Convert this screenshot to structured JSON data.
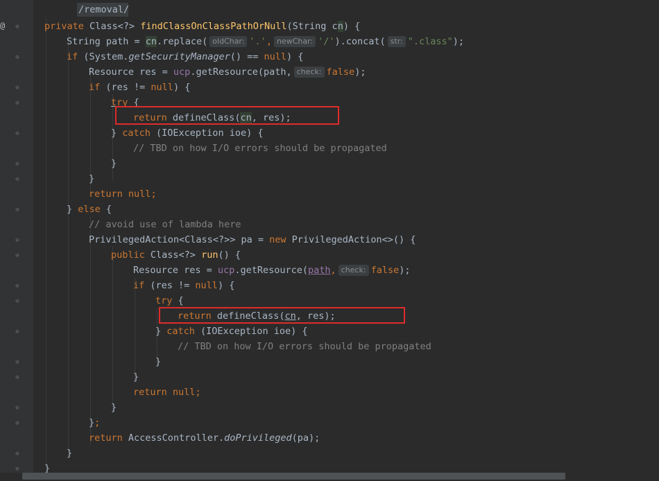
{
  "editor": {
    "gutter_marker": "@",
    "path_label": "/removal/",
    "lines": {
      "l1": {
        "kw1": "private",
        "t1": " Class<?> ",
        "fn": "findClassOnClassPathOrNull",
        "t2": "(String ",
        "cnA": "c",
        "cnB": "n",
        "t3": ") {"
      },
      "l2": {
        "t1": "String path = ",
        "cn": "cn",
        "t2": ".replace(",
        "hint1": "oldChar:",
        "s1": "'.'",
        "comma1": ",",
        "hint2": "newChar:",
        "s2": "'/'",
        "t3": ").concat(",
        "hint3": "str:",
        "s3": "\".class\"",
        "t4": ");"
      },
      "l3": {
        "kw": "if",
        "t1": " (System.",
        "m": "getSecurityManager",
        "t2": "() == ",
        "n": "null",
        "t3": ") {"
      },
      "l4": {
        "t1": "Resource res = ",
        "ucp": "ucp",
        "t2": ".getResource(path,",
        "hint": "check:",
        "f": "false",
        "t3": ");"
      },
      "l5": {
        "kw": "if",
        "t1": " (res != ",
        "n": "null",
        "t2": ") {"
      },
      "l6": {
        "kw": "try",
        "t1": " {"
      },
      "l7": {
        "kw": "return",
        "t1": " defineClass(",
        "cn": "cn",
        "t2": ", res);"
      },
      "l8": {
        "t1": "} ",
        "kw": "catch",
        "t2": " (IOException ioe) {"
      },
      "l9": {
        "cm": "// TBD on how I/O errors should be propagated"
      },
      "l10": {
        "t1": "}"
      },
      "l11": {
        "t1": "}"
      },
      "l12": {
        "kw": "return",
        "t1": " ",
        "n": "null",
        "t2": ";"
      },
      "l13": {
        "t1": "} ",
        "kw": "else",
        "t2": " {"
      },
      "l14": {
        "cm": "// avoid use of lambda here"
      },
      "l15": {
        "t1": "PrivilegedAction<Class<?>> pa = ",
        "kw": "new",
        "t2": " PrivilegedAction<>() {"
      },
      "l16": {
        "kw": "public",
        "t1": " Class<?> ",
        "fn": "run",
        "t2": "() {"
      },
      "l17": {
        "t1": "Resource res = ",
        "ucp": "ucp",
        "t2": ".getResource(",
        "path": "path",
        "comma": ",",
        "hint": "check:",
        "f": "false",
        "t3": ");"
      },
      "l18": {
        "kw": "if",
        "t1": " (res != ",
        "n": "null",
        "t2": ") {"
      },
      "l19": {
        "kw": "try",
        "t1": " {"
      },
      "l20": {
        "kw": "return",
        "t1": " defineClass(",
        "cn": "cn",
        "t2": ", res);"
      },
      "l21": {
        "t1": "} ",
        "kw": "catch",
        "t2": " (IOException ioe) {"
      },
      "l22": {
        "cm": "// TBD on how I/O errors should be propagated"
      },
      "l23": {
        "t1": "}"
      },
      "l24": {
        "t1": "}"
      },
      "l25": {
        "kw": "return",
        "t1": " ",
        "n": "null",
        "t2": ";"
      },
      "l26": {
        "t1": "}"
      },
      "l27": {
        "t1": "}",
        "semi": ";"
      },
      "l28": {
        "kw": "return",
        "t1": " AccessController.",
        "m": "doPrivileged",
        "t2": "(pa);"
      },
      "l29": {
        "t1": "}"
      },
      "l30": {
        "t1": "}"
      }
    }
  },
  "colors": {
    "background": "#2b2b2b",
    "keyword": "#cc7832",
    "method_decl": "#ffc66d",
    "string": "#6a8759",
    "comment": "#808080",
    "field": "#9876aa",
    "highlight_box": "#e02b2b"
  },
  "icons": [
    "fold-marker-icon",
    "override-marker-icon"
  ]
}
